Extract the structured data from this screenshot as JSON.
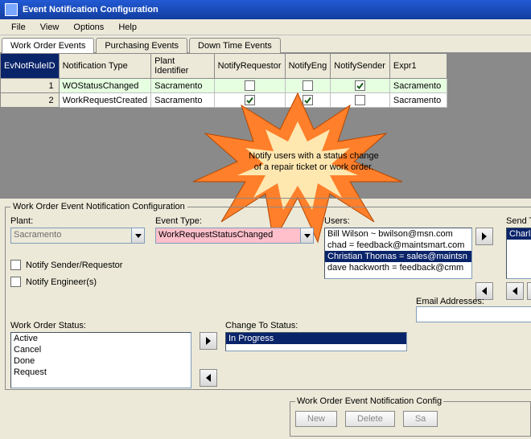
{
  "window": {
    "title": "Event Notification Configuration"
  },
  "menu": {
    "file": "File",
    "view": "View",
    "options": "Options",
    "help": "Help"
  },
  "tabs": {
    "wo": "Work Order Events",
    "pu": "Purchasing Events",
    "dt": "Down Time Events"
  },
  "grid": {
    "headers": {
      "id": "EvNotRuleID",
      "ntype": "Notification Type",
      "plant": "Plant Identifier",
      "nreq": "NotifyRequestor",
      "neng": "NotifyEng",
      "nsend": "NotifySender",
      "expr": "Expr1"
    },
    "rows": [
      {
        "id": "1",
        "ntype": "WOStatusChanged",
        "plant": "Sacramento",
        "nreq": false,
        "neng": false,
        "nsend": true,
        "expr": "Sacramento"
      },
      {
        "id": "2",
        "ntype": "WorkRequestCreated",
        "plant": "Sacramento",
        "nreq": true,
        "neng": true,
        "nsend": false,
        "expr": "Sacramento"
      }
    ]
  },
  "callout": {
    "line1": "Notify users with a status change",
    "line2": "of a repair ticket or work order."
  },
  "form": {
    "legend": "Work Order Event Notification Configuration",
    "plant_label": "Plant:",
    "plant_value": "Sacramento",
    "event_label": "Event Type:",
    "event_value": "WorkRequestStatusChanged",
    "users_label": "Users:",
    "users": [
      "Bill Wilson ~ bwilson@msn.com",
      "chad = feedback@maintsmart.com",
      "Christian Thomas = sales@maintsn",
      "dave hackworth = feedback@cmm"
    ],
    "users_selected_index": 2,
    "sendto_label": "Send To U",
    "sendto": [
      "Charlie Hus"
    ],
    "notify_sender": "Notify Sender/Requestor",
    "notify_eng": "Notify Engineer(s)",
    "email_label": "Email Addresses:",
    "wos_label": "Work Order Status:",
    "wos": [
      "Active",
      "Cancel",
      "Done",
      "Request"
    ],
    "chs_label": "Change To Status:",
    "chs_selected": "In Progress",
    "bottom_legend": "Work Order Event Notification Config",
    "btn_new": "New",
    "btn_delete": "Delete",
    "btn_save": "Sa"
  }
}
